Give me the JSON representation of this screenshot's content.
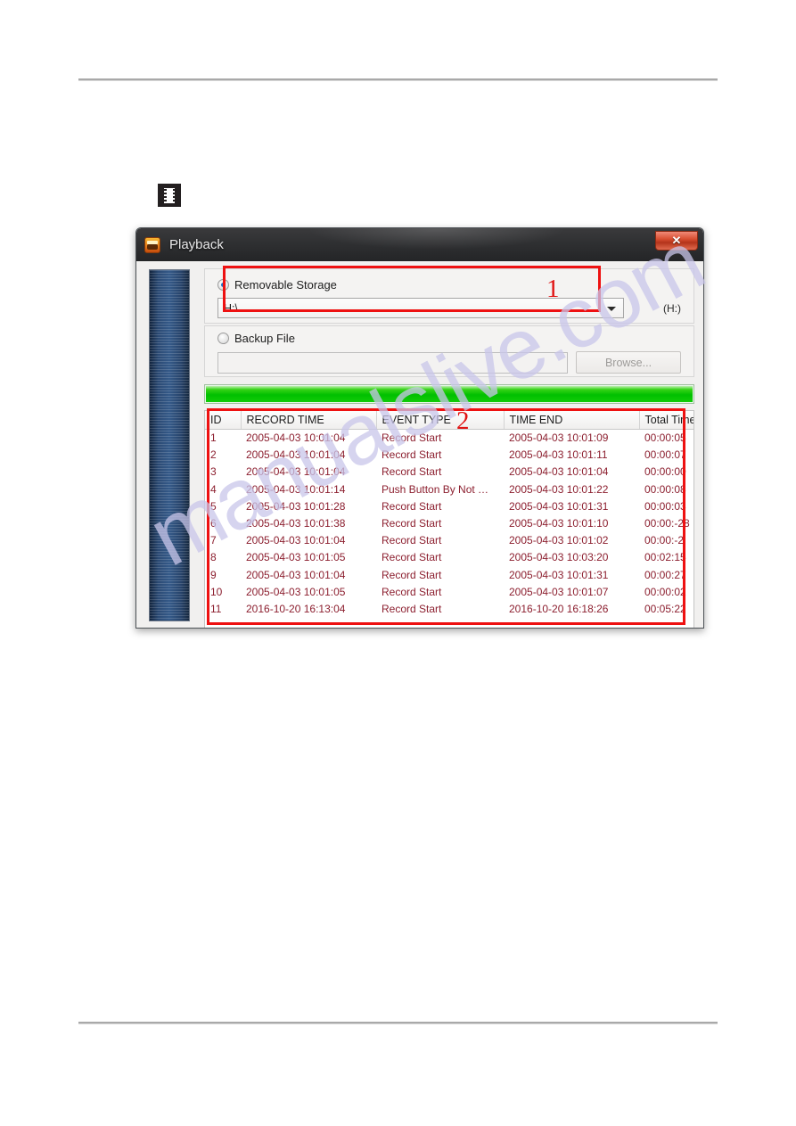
{
  "page": {
    "film_icon_name": "film-strip-icon",
    "watermark_text": "manualslive.com"
  },
  "dialog": {
    "title": "Playback",
    "close_label": "✕",
    "removable": {
      "radio_label": "Removable Storage",
      "selected": true,
      "combo_value": "H:\\",
      "drive_label": "(H:)"
    },
    "backup": {
      "radio_label": "Backup File",
      "selected": false,
      "path_value": "",
      "browse_label": "Browse...",
      "browse_disabled": true
    },
    "progress": {
      "percent": 100
    }
  },
  "annotations": [
    {
      "number": "1"
    },
    {
      "number": "2"
    }
  ],
  "table": {
    "columns": [
      "ID",
      "RECORD TIME",
      "EVENT TYPE",
      "TIME END",
      "Total Times"
    ],
    "rows": [
      {
        "id": "1",
        "record_time": "2005-04-03 10:01:04",
        "event_type": "Record Start",
        "time_end": "2005-04-03 10:01:09",
        "total": "00:00:05"
      },
      {
        "id": "2",
        "record_time": "2005-04-03 10:01:04",
        "event_type": "Record Start",
        "time_end": "2005-04-03 10:01:11",
        "total": "00:00:07"
      },
      {
        "id": "3",
        "record_time": "2005-04-03 10:01:04",
        "event_type": "Record Start",
        "time_end": "2005-04-03 10:01:04",
        "total": "00:00:00"
      },
      {
        "id": "4",
        "record_time": "2005-04-03 10:01:14",
        "event_type": "Push Button By Not …",
        "time_end": "2005-04-03 10:01:22",
        "total": "00:00:08"
      },
      {
        "id": "5",
        "record_time": "2005-04-03 10:01:28",
        "event_type": "Record Start",
        "time_end": "2005-04-03 10:01:31",
        "total": "00:00:03"
      },
      {
        "id": "6",
        "record_time": "2005-04-03 10:01:38",
        "event_type": "Record Start",
        "time_end": "2005-04-03 10:01:10",
        "total": "00:00:-28"
      },
      {
        "id": "7",
        "record_time": "2005-04-03 10:01:04",
        "event_type": "Record Start",
        "time_end": "2005-04-03 10:01:02",
        "total": "00:00:-2"
      },
      {
        "id": "8",
        "record_time": "2005-04-03 10:01:05",
        "event_type": "Record Start",
        "time_end": "2005-04-03 10:03:20",
        "total": "00:02:15"
      },
      {
        "id": "9",
        "record_time": "2005-04-03 10:01:04",
        "event_type": "Record Start",
        "time_end": "2005-04-03 10:01:31",
        "total": "00:00:27"
      },
      {
        "id": "10",
        "record_time": "2005-04-03 10:01:05",
        "event_type": "Record Start",
        "time_end": "2005-04-03 10:01:07",
        "total": "00:00:02"
      },
      {
        "id": "11",
        "record_time": "2016-10-20 16:13:04",
        "event_type": "Record Start",
        "time_end": "2016-10-20 16:18:26",
        "total": "00:05:22"
      }
    ]
  }
}
